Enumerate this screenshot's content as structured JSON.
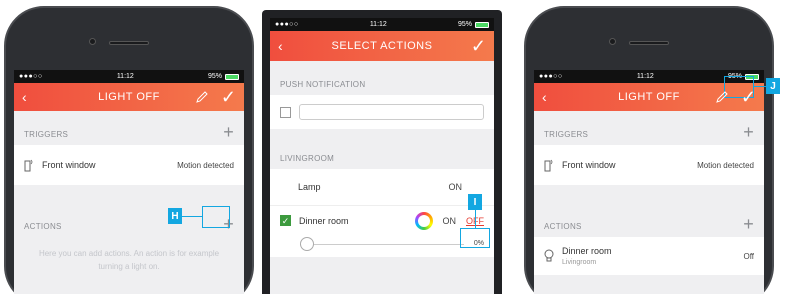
{
  "status": {
    "carrier": "●●●○○",
    "time": "11:12",
    "battery": "95%"
  },
  "screen1": {
    "title": "LIGHT OFF",
    "triggers_header": "TRIGGERS",
    "trigger_name": "Front window",
    "trigger_state": "Motion detected",
    "actions_header": "ACTIONS",
    "empty_text": "Here you can add actions. An action is for example turning a light on.",
    "callout": "H"
  },
  "screen2": {
    "title": "SELECT ACTIONS",
    "push_header": "PUSH NOTIFICATION",
    "room_header": "LIVINGROOM",
    "lamp_label": "Lamp",
    "lamp_on": "ON",
    "dinner_label": "Dinner room",
    "dinner_on": "ON",
    "dinner_off": "OFF",
    "dinner_percent": "0%",
    "dimmer_level": 0,
    "callout": "I"
  },
  "screen3": {
    "title": "LIGHT OFF",
    "triggers_header": "TRIGGERS",
    "trigger_name": "Front window",
    "trigger_state": "Motion detected",
    "actions_header": "ACTIONS",
    "action_name": "Dinner room",
    "action_room": "Livingroom",
    "action_state": "Off",
    "callout": "J"
  },
  "colors": {
    "accent": "#f04e3e",
    "callout": "#13a7e1",
    "check": "#3c9a3e"
  }
}
